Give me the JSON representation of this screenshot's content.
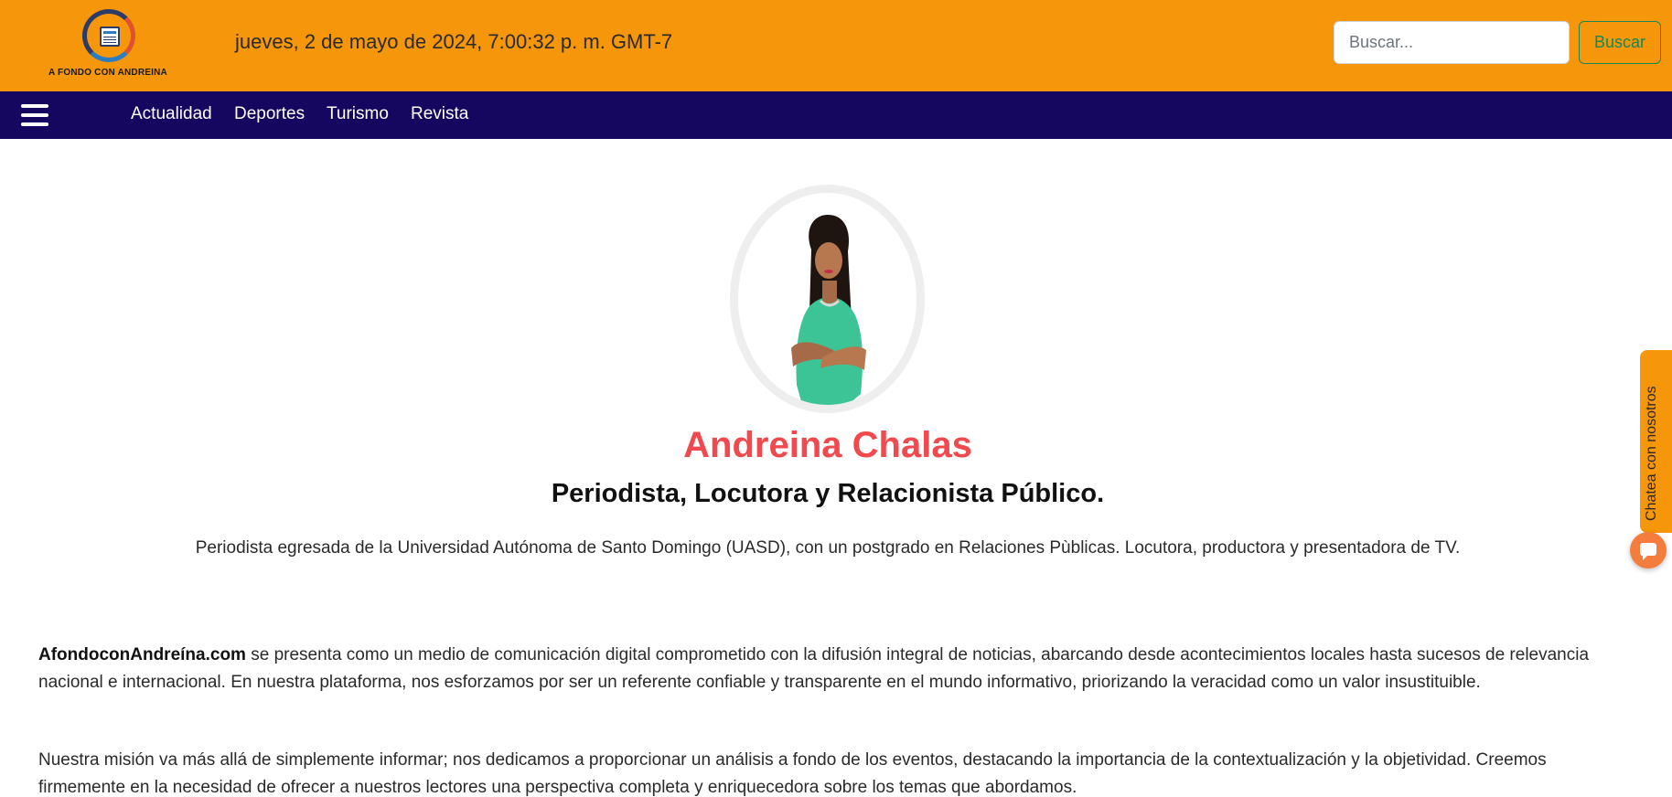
{
  "header": {
    "logo_text": "A FONDO CON ANDREINA",
    "logo_badge": "NEWS",
    "datetime": "jueves, 2 de mayo de 2024, 7:00:32 p. m. GMT-7",
    "search_placeholder": "Buscar...",
    "search_button": "Buscar"
  },
  "nav": {
    "items": [
      "Actualidad",
      "Deportes",
      "Turismo",
      "Revista"
    ]
  },
  "profile": {
    "name": "Andreina Chalas",
    "role": "Periodista, Locutora y Relacionista Público.",
    "bio": "Periodista egresada de la Universidad Autónoma de Santo Domingo (UASD), con un postgrado en Relaciones Pùblicas. Locutora, productora y presentadora de TV."
  },
  "about": {
    "brand": "AfondoconAndreína.com",
    "paragraph1_rest": " se presenta como un medio de comunicación digital comprometido con la difusión integral de noticias, abarcando desde acontecimientos locales hasta sucesos de relevancia nacional e internacional. En nuestra plataforma, nos esforzamos por ser un referente confiable y transparente en el mundo informativo, priorizando la veracidad como un valor insustituible.",
    "paragraph2": "Nuestra misión va más allá de simplemente informar; nos dedicamos a proporcionar un análisis a fondo de los eventos, destacando la importancia de la contextualización y la objetividad. Creemos firmemente en la necesidad de ofrecer a nuestros lectores una perspectiva completa y enriquecedora sobre los temas que abordamos."
  },
  "chat": {
    "tab_label": "Chatea con nosotros",
    "bubble_icon": "chat-icon"
  },
  "colors": {
    "header_bg": "#f5960b",
    "nav_bg": "#15065f",
    "name_color": "#f04a4f",
    "search_btn": "#198754"
  },
  "icons": {
    "menu": "hamburger-menu-icon"
  }
}
